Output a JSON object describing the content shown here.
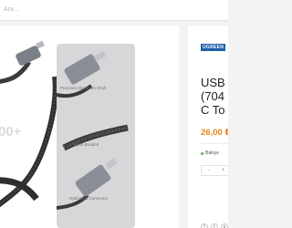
{
  "search": {
    "placeholder": "Ara..."
  },
  "product_image": {
    "badge_text": "00+",
    "captions": [
      "Premium Aluminum Shell",
      "Nylon Braided",
      "Optimized Connector"
    ],
    "brand_on_connector": "UGREEN"
  },
  "product": {
    "brand": "UGREEN",
    "title_lines": [
      "USB A",
      "(704",
      "C To"
    ],
    "price": "26,00 ₺",
    "stock_text": "Bakiye",
    "qty_minus": "-",
    "qty_plus": "+"
  },
  "social": [
    "f",
    "t",
    "p",
    "✉"
  ],
  "colors": {
    "accent": "#e8811a",
    "brand": "#1f5fa8",
    "in_stock": "#59b449"
  }
}
